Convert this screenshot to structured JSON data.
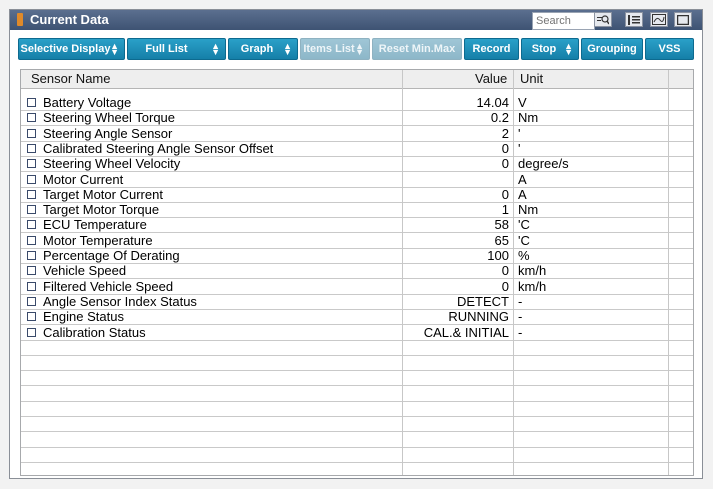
{
  "window": {
    "title": "Current Data",
    "search_placeholder": "Search"
  },
  "toolbar": {
    "selective_display": "Selective Display",
    "full_list": "Full List",
    "graph": "Graph",
    "items_list": "Items List",
    "reset_min_max": "Reset Min.Max",
    "record": "Record",
    "stop": "Stop",
    "grouping": "Grouping",
    "vss": "VSS"
  },
  "table": {
    "headers": {
      "name": "Sensor Name",
      "value": "Value",
      "unit": "Unit"
    },
    "rows": [
      {
        "name": "Battery Voltage",
        "value": "14.04",
        "unit": "V"
      },
      {
        "name": "Steering Wheel Torque",
        "value": "0.2",
        "unit": "Nm"
      },
      {
        "name": "Steering Angle Sensor",
        "value": "2",
        "unit": "'"
      },
      {
        "name": "Calibrated Steering Angle Sensor Offset",
        "value": "0",
        "unit": "'"
      },
      {
        "name": "Steering Wheel Velocity",
        "value": "0",
        "unit": "degree/s"
      },
      {
        "name": "Motor Current",
        "value": "",
        "unit": "A"
      },
      {
        "name": "Target Motor Current",
        "value": "0",
        "unit": "A"
      },
      {
        "name": "Target Motor Torque",
        "value": "1",
        "unit": "Nm"
      },
      {
        "name": "ECU Temperature",
        "value": "58",
        "unit": "'C"
      },
      {
        "name": "Motor Temperature",
        "value": "65",
        "unit": "'C"
      },
      {
        "name": "Percentage Of Derating",
        "value": "100",
        "unit": "%"
      },
      {
        "name": "Vehicle Speed",
        "value": "0",
        "unit": "km/h"
      },
      {
        "name": "Filtered Vehicle Speed",
        "value": "0",
        "unit": "km/h"
      },
      {
        "name": "Angle Sensor Index Status",
        "value": "DETECT",
        "unit": "-"
      },
      {
        "name": "Engine Status",
        "value": "RUNNING",
        "unit": "-"
      },
      {
        "name": "Calibration Status",
        "value": "CAL.& INITIAL",
        "unit": "-"
      }
    ]
  },
  "colors": {
    "titlebar": "#4a5f80",
    "button": "#1f8fbb",
    "button_disabled": "#9bc3d3"
  }
}
